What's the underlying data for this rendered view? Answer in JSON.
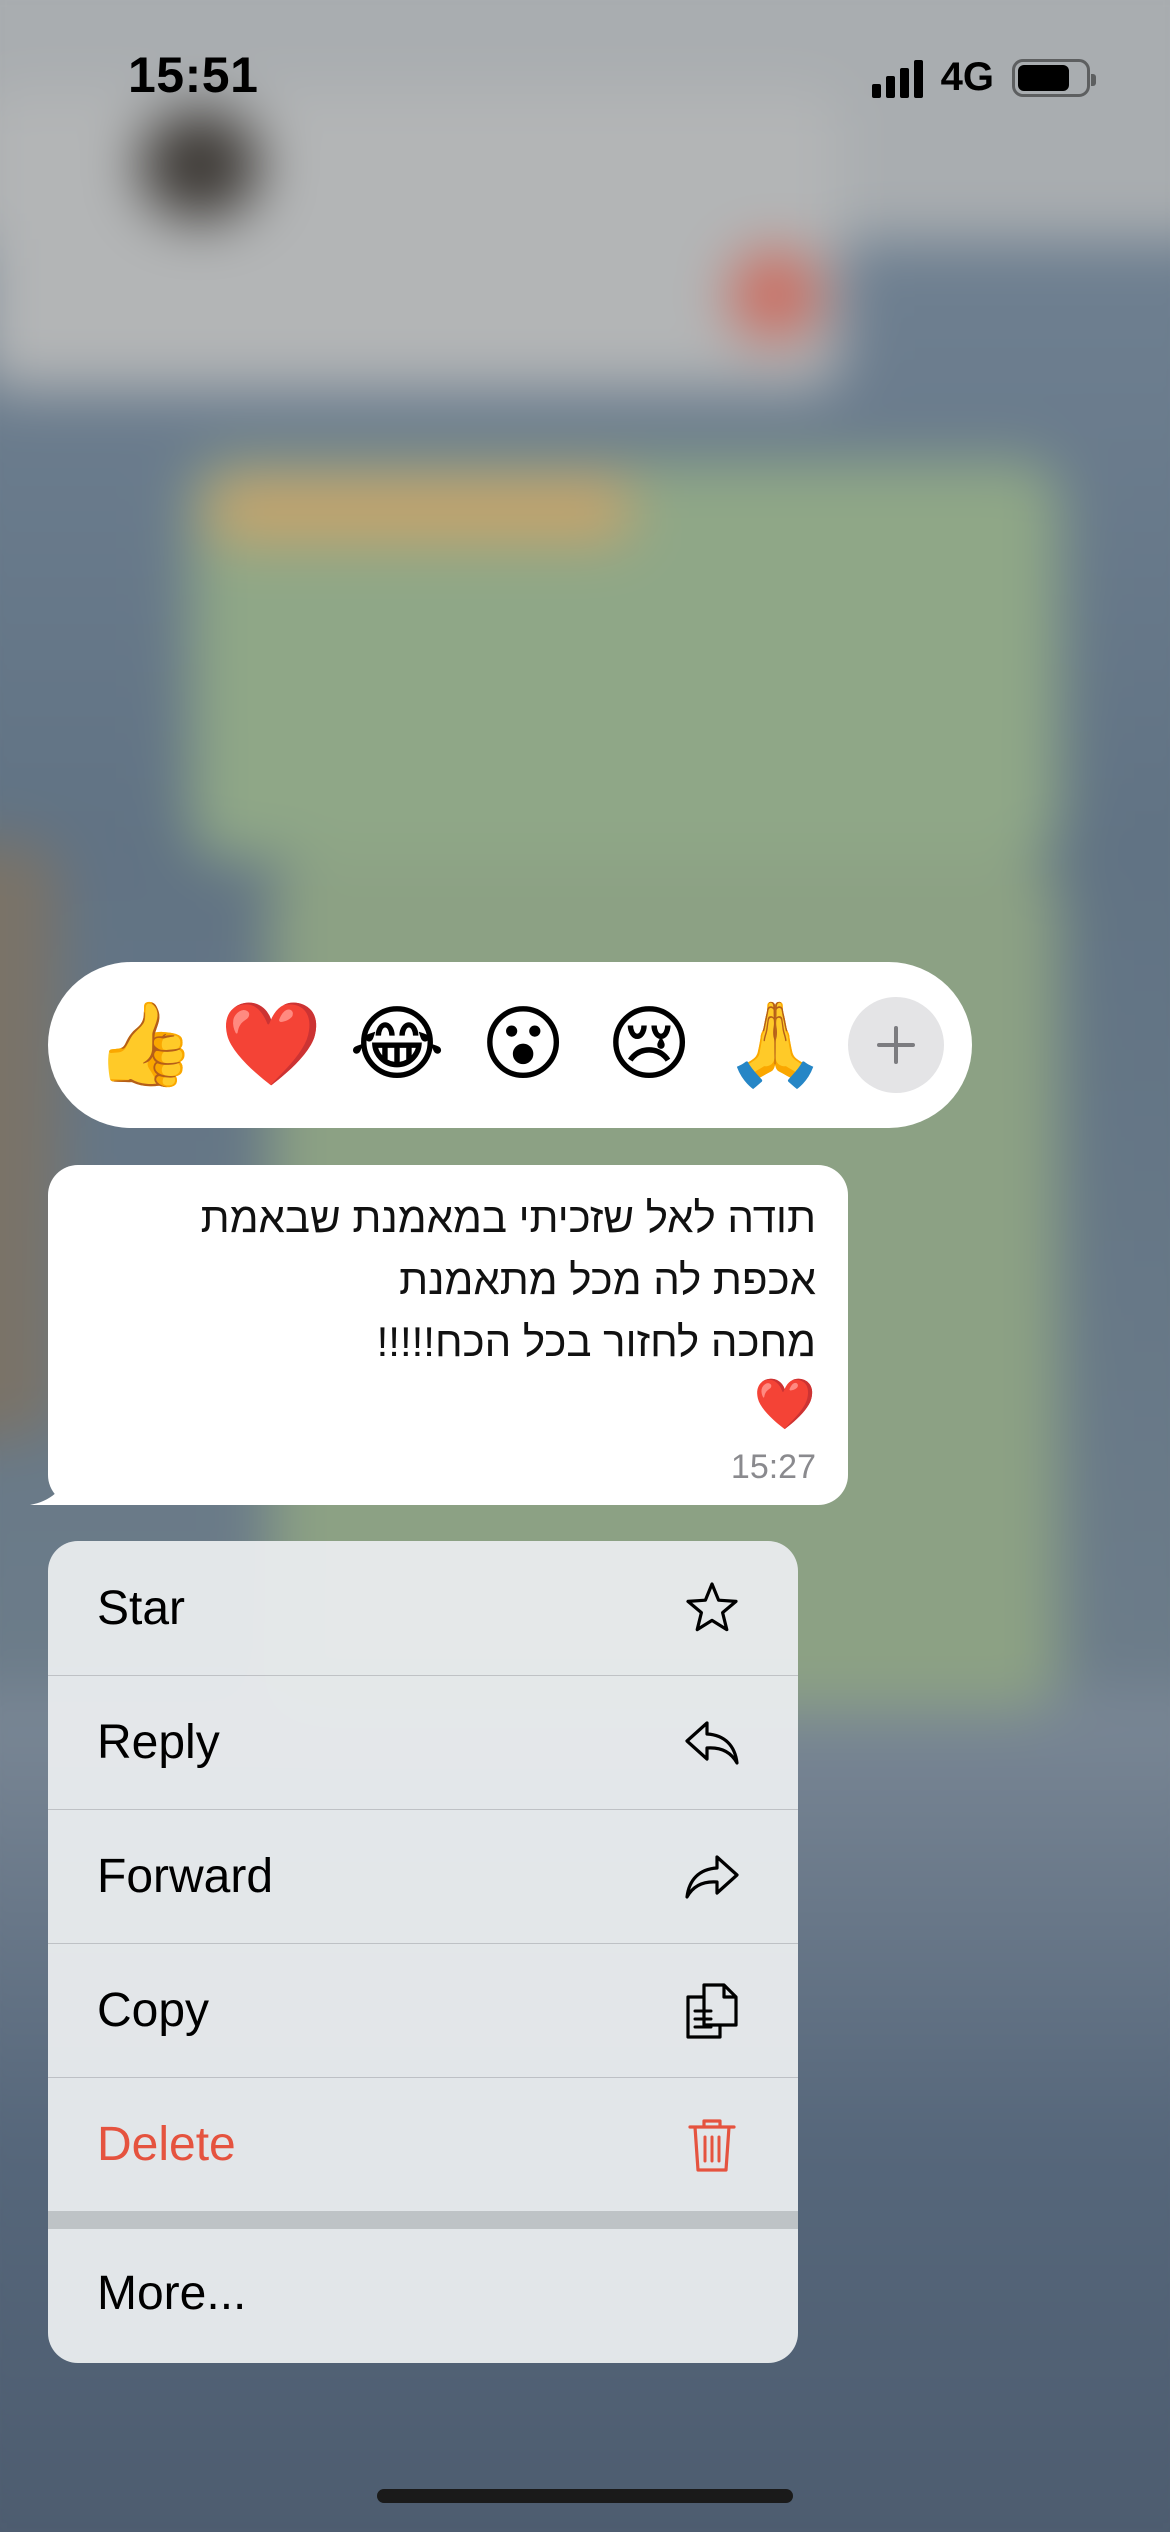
{
  "status_bar": {
    "time": "15:51",
    "network": "4G",
    "battery_level": 0.78
  },
  "reactions": [
    {
      "emoji": "👍",
      "name": "thumbs-up"
    },
    {
      "emoji": "❤️",
      "name": "red-heart"
    },
    {
      "emoji": "😂",
      "name": "tears-of-joy"
    },
    {
      "emoji": "😮",
      "name": "open-mouth"
    },
    {
      "emoji": "😢",
      "name": "crying-face"
    },
    {
      "emoji": "🙏",
      "name": "folded-hands"
    }
  ],
  "reaction_more_icon": "plus-icon",
  "message": {
    "lines": [
      "תודה לאל שזכיתי במאמנת שבאמת",
      "אכפת לה מכל מתאמנת",
      "מחכה לחזור בכל הכח!!!!!",
      "❤️"
    ],
    "time": "15:27"
  },
  "menu": {
    "items": [
      {
        "label": "Star",
        "icon": "star-icon"
      },
      {
        "label": "Reply",
        "icon": "reply-icon"
      },
      {
        "label": "Forward",
        "icon": "forward-icon"
      },
      {
        "label": "Copy",
        "icon": "copy-icon"
      },
      {
        "label": "Delete",
        "icon": "trash-icon"
      }
    ],
    "more_label": "More..."
  },
  "colors": {
    "destructive": "#e5533f",
    "bubble": "#ffffff",
    "menu_background": "#e8ebed"
  }
}
